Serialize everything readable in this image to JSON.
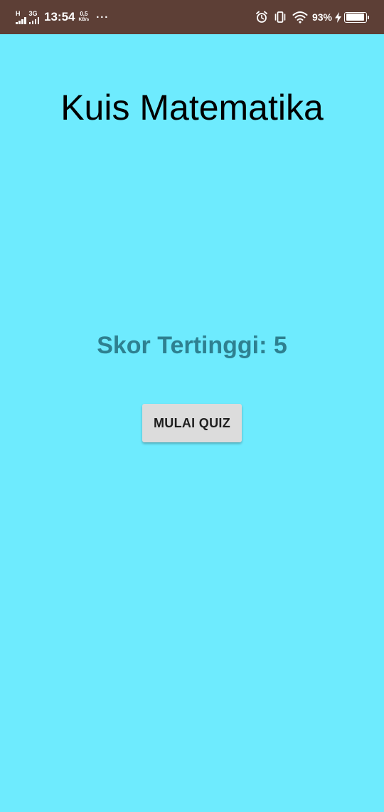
{
  "status_bar": {
    "signal1_label": "H",
    "signal2_label": "3G",
    "time": "13:54",
    "net_speed_value": "0,5",
    "net_speed_unit": "KB/s",
    "more_indicator": "···",
    "icons": [
      "alarm-icon",
      "vibrate-icon",
      "wifi-icon",
      "battery-icon",
      "charging-icon"
    ],
    "battery_percent_text": "93%",
    "battery_level": 0.93
  },
  "main": {
    "title": "Kuis Matematika",
    "high_score": "Skor Tertinggi: 5",
    "start_button_label": "MULAI QUIZ"
  },
  "colors": {
    "background": "#6eebfe",
    "status_bar": "#5d3f36",
    "score_text": "#2e8090",
    "button": "#dcdcdc"
  }
}
